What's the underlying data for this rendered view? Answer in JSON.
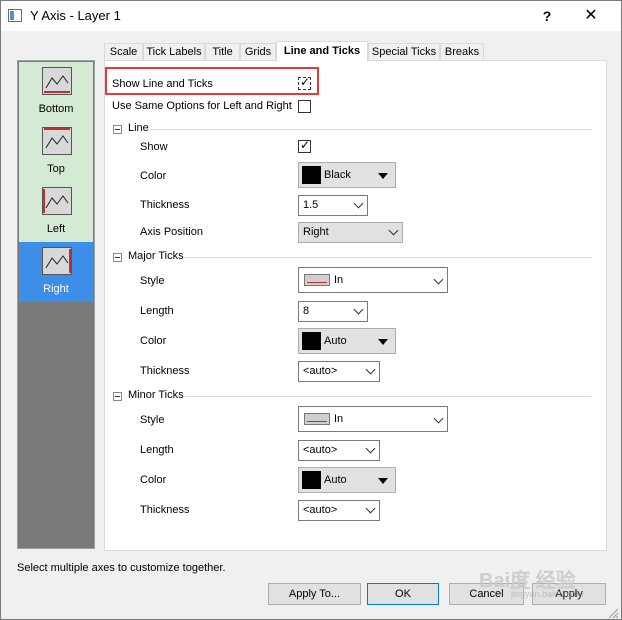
{
  "window": {
    "title": "Y Axis - Layer 1",
    "help": "?",
    "close": "✕"
  },
  "axes": [
    {
      "label": "Bottom",
      "selected": false
    },
    {
      "label": "Top",
      "selected": false
    },
    {
      "label": "Left",
      "selected": false
    },
    {
      "label": "Right",
      "selected": true
    }
  ],
  "tabs": [
    {
      "label": "Scale"
    },
    {
      "label": "Tick Labels"
    },
    {
      "label": "Title"
    },
    {
      "label": "Grids"
    },
    {
      "label": "Line and Ticks",
      "active": true
    },
    {
      "label": "Special Ticks"
    },
    {
      "label": "Breaks"
    }
  ],
  "panel": {
    "show_line_and_ticks": {
      "label": "Show Line and Ticks",
      "checked": true
    },
    "same_options": {
      "label": "Use Same Options for Left and Right",
      "checked": false
    },
    "line": {
      "title": "Line",
      "show_label": "Show",
      "show_checked": true,
      "color_label": "Color",
      "color_value": "Black",
      "thickness_label": "Thickness",
      "thickness_value": "1.5",
      "position_label": "Axis Position",
      "position_value": "Right"
    },
    "major": {
      "title": "Major Ticks",
      "style_label": "Style",
      "style_value": "In",
      "length_label": "Length",
      "length_value": "8",
      "color_label": "Color",
      "color_value": "Auto",
      "thickness_label": "Thickness",
      "thickness_value": "<auto>"
    },
    "minor": {
      "title": "Minor Ticks",
      "style_label": "Style",
      "style_value": "In",
      "length_label": "Length",
      "length_value": "<auto>",
      "color_label": "Color",
      "color_value": "Auto",
      "thickness_label": "Thickness",
      "thickness_value": "<auto>"
    }
  },
  "status_text": "Select multiple axes to customize together.",
  "buttons": {
    "apply_to": "Apply To...",
    "ok": "OK",
    "cancel": "Cancel",
    "apply": "Apply"
  },
  "watermark": {
    "main": "Bai度 经验",
    "sub": "jingyan.baidu.com"
  },
  "colors": {
    "selected_axis": "#3d8ee6",
    "axis_item": "#d4ead4",
    "highlight": "#e23b3b"
  }
}
